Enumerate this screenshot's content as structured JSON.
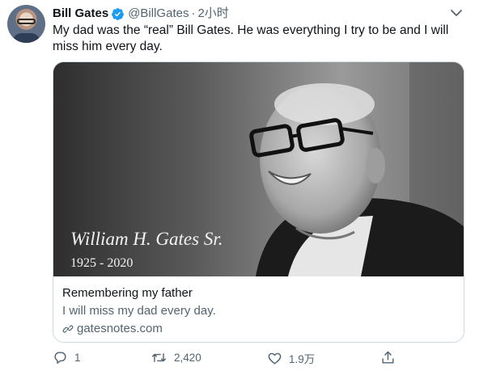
{
  "author": {
    "name": "Bill Gates",
    "handle": "@BillGates",
    "separator": "·",
    "time": "2小时"
  },
  "tweet": {
    "text": "My dad was the “real” Bill Gates. He was everything I try to be and I will miss him every day."
  },
  "card": {
    "image_caption_name": "William H. Gates Sr.",
    "image_caption_years": "1925 - 2020",
    "title": "Remembering my father",
    "description": "I will miss my dad every day.",
    "domain": "gatesnotes.com"
  },
  "actions": {
    "replies": "1",
    "retweets": "2,420",
    "likes": "1.9万"
  },
  "colors": {
    "verified": "#1d9bf0",
    "muted": "#536471",
    "text": "#0f1419",
    "border": "#cfd9de"
  },
  "icons": [
    "verified-badge-icon",
    "chevron-down-icon",
    "link-icon",
    "reply-icon",
    "retweet-icon",
    "like-icon",
    "share-icon"
  ]
}
